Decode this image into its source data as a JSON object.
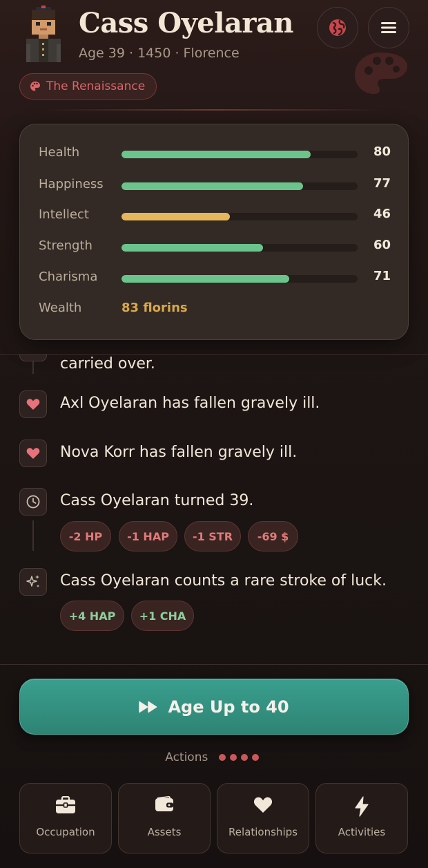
{
  "header": {
    "name": "Cass Oyelaran",
    "subtitle": "Age 39 · 1450 · Florence",
    "era_badge": "The Renaissance",
    "icons": [
      "globe-icon",
      "menu-icon",
      "palette-icon"
    ]
  },
  "stats": {
    "items": [
      {
        "label": "Health",
        "value": "80",
        "percent": 80,
        "color": "#6cc48d"
      },
      {
        "label": "Happiness",
        "value": "77",
        "percent": 77,
        "color": "#6cc48d"
      },
      {
        "label": "Intellect",
        "value": "46",
        "percent": 46,
        "color": "#e6b65c"
      },
      {
        "label": "Strength",
        "value": "60",
        "percent": 60,
        "color": "#6cc48d"
      },
      {
        "label": "Charisma",
        "value": "71",
        "percent": 71,
        "color": "#6cc48d"
      }
    ],
    "wealth_label": "Wealth",
    "wealth_value": "83 florins"
  },
  "feed": {
    "events": [
      {
        "icon": "heart-icon",
        "text": "carried over."
      },
      {
        "icon": "heart-icon",
        "text": "Axl Oyelaran has fallen gravely ill."
      },
      {
        "icon": "heart-icon",
        "text": "Nova Korr has fallen gravely ill."
      },
      {
        "icon": "clock-icon",
        "text": "Cass Oyelaran turned 39.",
        "chips": [
          "-2 HP",
          "-1 HAP",
          "-1 STR",
          "-69 $"
        ]
      },
      {
        "icon": "sparkles-icon",
        "text": "Cass Oyelaran counts a rare stroke of luck.",
        "chips": [
          "+4 HAP",
          "+1 CHA"
        ]
      }
    ]
  },
  "age_button": {
    "label": "Age Up to 40",
    "icon": "fast-forward-icon"
  },
  "actions": {
    "label": "Actions",
    "items": [
      {
        "label": "Occupation",
        "icon": "briefcase-icon"
      },
      {
        "label": "Assets",
        "icon": "wallet-icon"
      },
      {
        "label": "Relationships",
        "icon": "heart-icon"
      },
      {
        "label": "Activities",
        "icon": "lightning-icon"
      }
    ]
  },
  "colors": {
    "accent": "#3a9e8e",
    "negative": "#e07a78",
    "positive": "#8ccf9a",
    "gold": "#d9a84a",
    "badge": "#d9666a"
  }
}
